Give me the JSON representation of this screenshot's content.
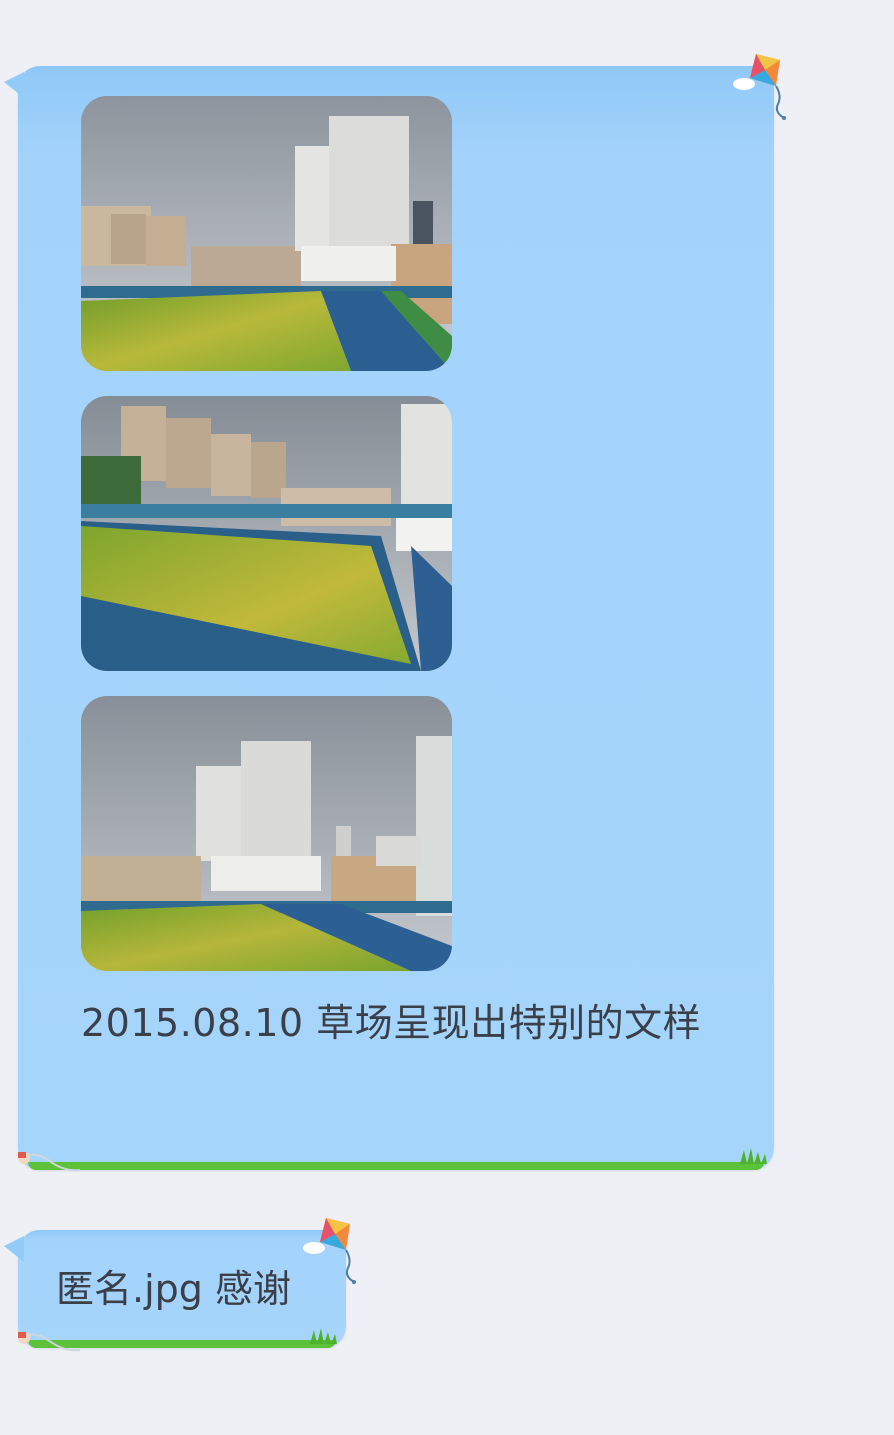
{
  "conversation": {
    "messages": [
      {
        "type": "photos-with-caption",
        "photos": [
          {
            "alt": "photo-1",
            "icon": "image-icon"
          },
          {
            "alt": "photo-2",
            "icon": "image-icon"
          },
          {
            "alt": "photo-3",
            "icon": "image-icon"
          }
        ],
        "caption": "2015.08.10 草场呈现出特别的文样"
      },
      {
        "type": "text",
        "text": "匿名.jpg 感谢"
      }
    ]
  },
  "theme": {
    "bubble_color": "#a6d5fb",
    "bubble_border_green": "#5cc23a",
    "background": "#eef0f5",
    "decorations": [
      "kite-icon",
      "hand-icon",
      "grass-icon"
    ]
  }
}
